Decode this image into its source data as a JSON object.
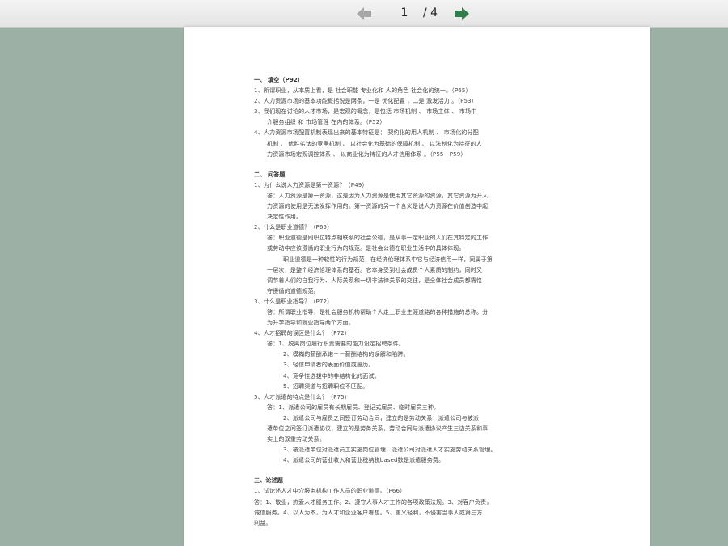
{
  "toolbar": {
    "page_current": "1",
    "page_total": "/ 4",
    "prev_icon": "arrow-left-icon",
    "next_icon": "arrow-right-icon",
    "prev_color": "#a7a7a7",
    "next_color": "#2e7d4a"
  },
  "doc": {
    "s1_title": "一、      填空（P92）",
    "s1_lines": [
      "1、所谓职业，从本质上看，是 社会职能 专业化和 人的角色 社会化的统一。（P65）",
      "2、人力资源市场的基本功能概括说是两条，一是 优化配置 ，二是 激发活力 。（P53）",
      "3、我们现在讨论的人才市场，是宏观的概念，是包括 市场机制 、 市场主体 、 市场中",
      "介服务组织 和 市场管理 在内的体系。（P52）",
      "4、人力资源市场配置机制表现出来的基本特征是： 契约化的用人机制 、 市场化的分配",
      "机制 、 优胜劣汰的竞争机制 、 以社会化为基础的保障机制 、 以法制化为特征的人",
      "力资源市场宏观调控体系 、 以商业化为特征的人才信用体系 。（P55－P59）"
    ],
    "s2_title": "二、      问答题",
    "s2_lines": [
      "1、为什么说人力资源是第一资源？（P49）",
      "答：人力资源是第一资源，这是因为人力资源是使用其它资源的资源，其它资源为开人",
      "力资源的使用是无法发挥作用的。第一资源的另一个含义是说人力资源在价值创造中起",
      "决定性作用。",
      "2、什么是职业道德？（P65）",
      "答：职业道德是同职位特点相联系的社会公德，是从事一定职业的人们在其特定的工作",
      "或劳动中应该遵循的职业行为的规范。是社会公德在职业生活中的具体体现。",
      "职业道德是一种软性的行为规范，在经济伦理体系中它与经济信用一样，同属于第",
      "一层次，是整个经济伦理体系的基石。它本身受到社会成员个人素质的制约，同时又",
      "调节着人们的自我行为、人际关系和一切非法律关系的交往，是全体社会成员都需恪",
      "守遵循的道德规范。",
      "3、什么是职业指导？（P72）",
      "答：所谓职业指导，是社会服务机构帮助个人走上职业生涯道路的各种措施的总称。分",
      "为升学指导和就业指导两个方面。",
      "4、人才招聘的误区是什么？（P72）",
      "答：1、脱离岗位履行职责需要的能力设定招聘条件。",
      "2、模糊的薪酬承诺－－薪酬结构的误解和陷阱。",
      "3、轻信申请者的表面价值或履历。",
      "4、竞争性选拔中的非结构化的面试。",
      "5、招聘渠道与招聘职位不匹配。",
      "5、人才派遣的特点是什么？（P75）",
      "答：1、派遣公司的雇员有长期雇员、登记式雇员、临时雇员三种。",
      "2、派遣公司与雇员之间签订劳动合同，建立的是劳动关系；派遣公司与被派",
      "遣单位之间签订派遣协议，建立的是劳务关系，劳动合同与派遣协议产生三边关系和事",
      "实上的双重劳动关系。",
      "3、被派遣单位对派遣员工实施岗位管理，派遣公司对派遣人才实施劳动关系管理。",
      "4、派遣公司的营业收入和营业税纳税based数是派遣服务费。"
    ],
    "s3_title": "三、论述题",
    "s3_lines": [
      "1、试论述人才中介服务机构工作人员的职业道德。（P66）",
      "答：1、敬业，热爱人才服务工作。2、遵守人事人才工作的各项政策法规。3、对客户负责，",
      "诚信服务。4、以人为本，为人才和企业客户着想。5、重义轻利，不侵害当事人或第三方",
      "利益。"
    ]
  }
}
